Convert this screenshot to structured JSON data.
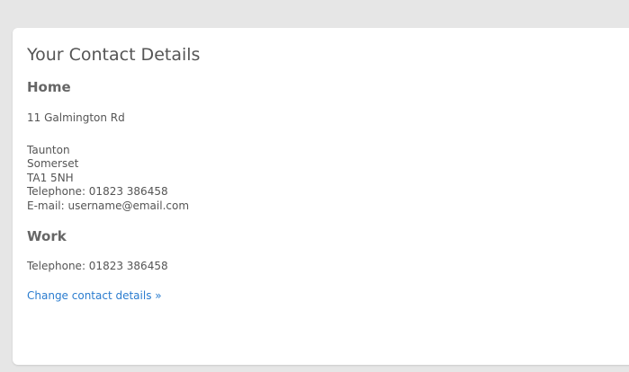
{
  "card": {
    "title": "Your Contact Details",
    "home": {
      "heading": "Home",
      "address_line1": "11 Galmington Rd",
      "town": "Taunton",
      "county": "Somerset",
      "postcode": "TA1 5NH",
      "telephone": "Telephone: 01823 386458",
      "email": "E-mail: username@email.com"
    },
    "work": {
      "heading": "Work",
      "telephone": "Telephone: 01823 386458"
    },
    "change_link": "Change contact details »"
  },
  "colors": {
    "page_background": "#e6e6e6",
    "card_background": "#ffffff",
    "heading_text": "#555555",
    "link": "#2a7ccf"
  }
}
